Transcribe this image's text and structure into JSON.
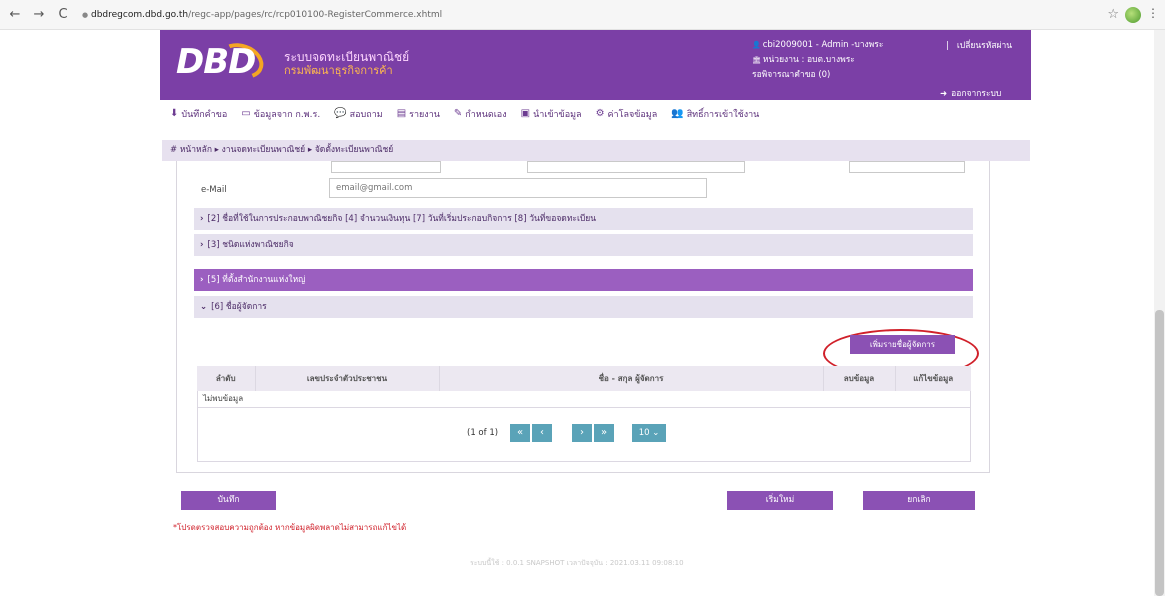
{
  "browser": {
    "url_host": "dbdregcom.dbd.go.th",
    "url_path": "/regc-app/pages/rc/rcp010100-RegisterCommerce.xhtml",
    "back_icon": "←",
    "forward_icon": "→",
    "reload_icon": "C",
    "lock_icon": "●",
    "star_icon": "☆",
    "menu_icon": "⋮"
  },
  "header": {
    "logo_text": "DBD",
    "system_title": "ระบบจดทะเบียนพาณิชย์",
    "system_subtitle": "กรมพัฒนาธุรกิจการค้า",
    "user_line": "cbi2009001 - Admin -บางพระ",
    "switch_link": "เปลี่ยนรหัสผ่าน",
    "unit_line": "หน่วยงาน : อบต.บางพระ",
    "pending_line": "รอพิจารณาคำขอ (0)",
    "logout_label": "ออกจากระบบ",
    "separator": "|",
    "user_icon": "👤",
    "unit_icon": "🏛",
    "logout_icon": "➜"
  },
  "menu": {
    "items": [
      {
        "icon": "⬇",
        "label": "บันทึกคำขอ"
      },
      {
        "icon": "▭",
        "label": "ข้อมูลจาก ก.พ.ร."
      },
      {
        "icon": "💬",
        "label": "สอบถาม"
      },
      {
        "icon": "▤",
        "label": "รายงาน"
      },
      {
        "icon": "✎",
        "label": "กำหนดเอง"
      },
      {
        "icon": "▣",
        "label": "นำเข้าข้อมูล"
      },
      {
        "icon": "⚙",
        "label": "ค่าโลจข้อมูล"
      },
      {
        "icon": "👥",
        "label": "สิทธิ์การเข้าใช้งาน"
      }
    ]
  },
  "breadcrumb": {
    "text": "# หน้าหลัก ▸ งานจดทะเบียนพาณิชย์ ▸ จัดตั้งทะเบียนพาณิชย์"
  },
  "form": {
    "email_label": "e-Mail",
    "email_placeholder": "email@gmail.com"
  },
  "sections": [
    {
      "chev": "›",
      "label": "[2] ชื่อที่ใช้ในการประกอบพาณิชยกิจ [4] จำนวนเงินทุน [7] วันที่เริ่มประกอบกิจการ [8] วันที่ขอจดทะเบียน"
    },
    {
      "chev": "›",
      "label": "[3] ชนิดแห่งพาณิชยกิจ"
    },
    {
      "chev": "›",
      "label": "[5] ที่ตั้งสำนักงานแห่งใหญ่"
    },
    {
      "chev": "⌄",
      "label": "[6] ชื่อผู้จัดการ"
    }
  ],
  "managers": {
    "add_button": "เพิ่มรายชื่อผู้จัดการ",
    "columns": [
      "ลำดับ",
      "เลขประจำตัวประชาชน",
      "ชื่อ - สกุล ผู้จัดการ",
      "ลบข้อมูล",
      "แก้ไขข้อมูล"
    ],
    "empty_text": "ไม่พบข้อมูล",
    "pager_info": "(1 of 1)",
    "first_label": "«",
    "prev_label": "‹",
    "next_label": "›",
    "last_label": "»",
    "rows_per_page": "10 ⌄"
  },
  "footer": {
    "save_button": "บันทึก",
    "reset_button": "เริ่มใหม่",
    "cancel_button": "ยกเลิก",
    "warning": "*โปรดตรวจสอบความถูกต้อง หากข้อมูลผิดพลาดไม่สามารถแก้ไขได้",
    "version": "ระบบนี้ใช้ : 0.0.1 SNAPSHOT เวลาปัจจุบัน : 2021.03.11 09:08:10"
  },
  "colors": {
    "brand_purple": "#7b3fa6",
    "section_bg": "#e5e1ee",
    "active_section": "#9b5fc0",
    "annotation_red": "#d0202a",
    "pager_teal": "#5aa3b8"
  }
}
